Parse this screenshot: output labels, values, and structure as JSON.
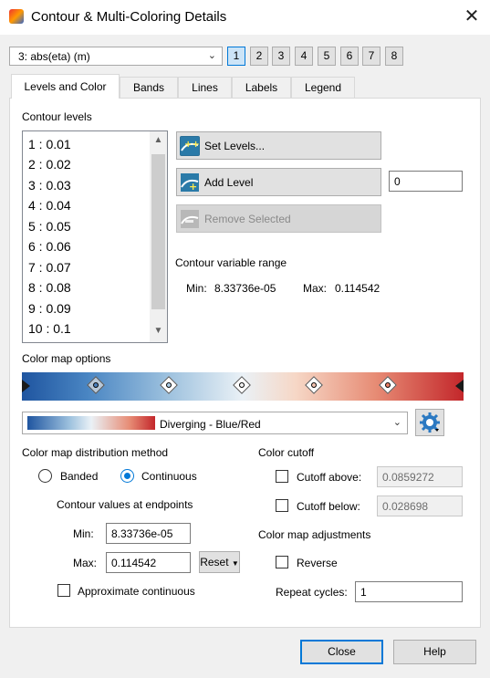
{
  "window": {
    "title": "Contour & Multi-Coloring Details",
    "close": "✕"
  },
  "group_select": {
    "value": "3: abs(eta) (m)"
  },
  "group_buttons": [
    "1",
    "2",
    "3",
    "4",
    "5",
    "6",
    "7",
    "8"
  ],
  "tabs": [
    {
      "label": "Levels and Color",
      "active": true
    },
    {
      "label": "Bands"
    },
    {
      "label": "Lines"
    },
    {
      "label": "Labels"
    },
    {
      "label": "Legend"
    }
  ],
  "levels": {
    "heading": "Contour levels",
    "items": [
      "1 : 0.01",
      "2 : 0.02",
      "3 : 0.03",
      "4 : 0.04",
      "5 : 0.05",
      "6 : 0.06",
      "7 : 0.07",
      "8 : 0.08",
      "9 : 0.09",
      "10 : 0.1"
    ],
    "set_levels": "Set Levels...",
    "add_level": "Add Level",
    "add_level_value": "0",
    "remove_selected": "Remove Selected"
  },
  "range": {
    "heading": "Contour variable range",
    "min_label": "Min:",
    "min_value": "8.33736e-05",
    "max_label": "Max:",
    "max_value": "0.114542"
  },
  "colormap": {
    "heading": "Color map options",
    "name": "Diverging - Blue/Red",
    "colors": {
      "dark_blue": "#1f55a0",
      "mid": "#eaf1f6",
      "dark_red": "#c3272b"
    }
  },
  "distribution": {
    "heading": "Color map distribution method",
    "banded": "Banded",
    "continuous": "Continuous",
    "selected": "continuous",
    "endpoints_heading": "Contour values at endpoints",
    "min_label": "Min:",
    "min_value": "8.33736e-05",
    "max_label": "Max:",
    "max_value": "0.114542",
    "reset": "Reset",
    "approx": "Approximate continuous"
  },
  "cutoff": {
    "heading": "Color cutoff",
    "above_label": "Cutoff above:",
    "above_value": "0.0859272",
    "below_label": "Cutoff below:",
    "below_value": "0.028698"
  },
  "adjust": {
    "heading": "Color map adjustments",
    "reverse": "Reverse",
    "repeat_label": "Repeat cycles:",
    "repeat_value": "1"
  },
  "footer": {
    "close": "Close",
    "help": "Help"
  }
}
